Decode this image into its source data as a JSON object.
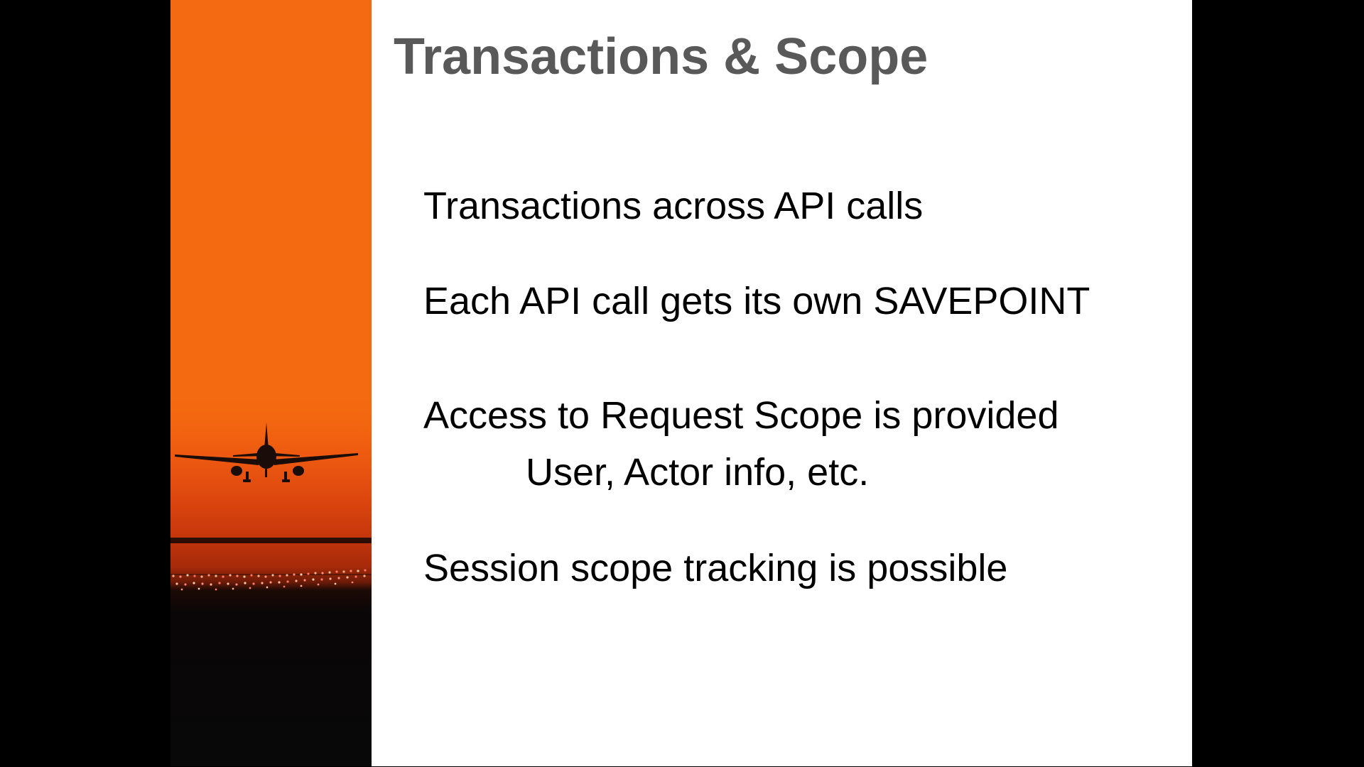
{
  "slide": {
    "title": "Transactions & Scope",
    "bullets": [
      {
        "text": "Transactions across API calls"
      },
      {
        "text": "Each API call gets its own SAVEPOINT"
      },
      {
        "text": "Access to Request Scope is provided",
        "sub": "User, Actor info, etc."
      },
      {
        "text": "Session scope tracking is possible"
      }
    ]
  },
  "colors": {
    "background": "#000000",
    "slide": "#ffffff",
    "title": "#595959",
    "body_text": "#000000",
    "sky_orange": "#f36a12",
    "ground_dark": "#080808"
  },
  "decor": {
    "photo": "airplane landing at sunset over runway lights"
  }
}
